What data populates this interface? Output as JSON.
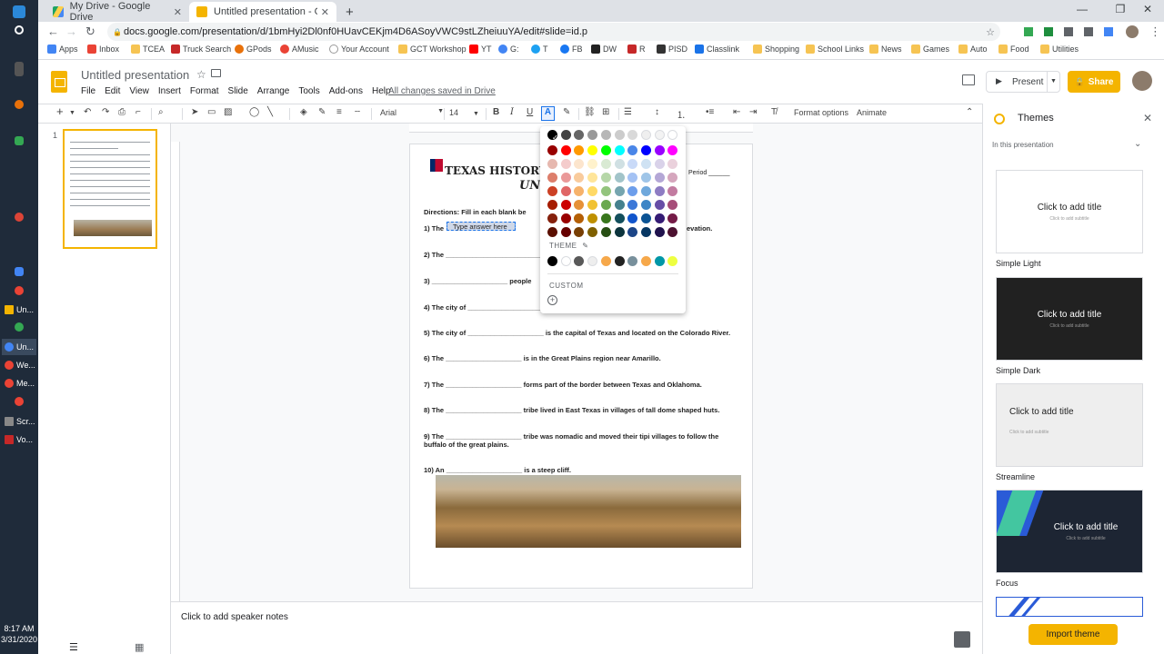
{
  "browser": {
    "tabs": [
      {
        "title": "My Drive - Google Drive",
        "active": false
      },
      {
        "title": "Untitled presentation - Google S",
        "active": true
      }
    ],
    "url": "docs.google.com/presentation/d/1bmHyi2Dl0nf0HUavCEKjm4D6ASoyVWC9stLZheiuuYA/edit#slide=id.p",
    "bookmarks": [
      "Apps",
      "Inbox",
      "TCEA",
      "Truck Search",
      "GPods",
      "AMusic",
      "Your Account",
      "GCT Workshop",
      "YT",
      "G:",
      "T",
      "FB",
      "DW",
      "R",
      "PISD",
      "Classlink",
      "Shopping",
      "School Links",
      "News",
      "Games",
      "Auto",
      "Food",
      "Utilities"
    ]
  },
  "taskbar": {
    "items": [
      "Un...",
      "Un...",
      "We...",
      "Me...",
      "Scr...",
      "Vo..."
    ],
    "time": "8:17 AM",
    "date": "3/31/2020"
  },
  "slides": {
    "title": "Untitled presentation",
    "menu": [
      "File",
      "Edit",
      "View",
      "Insert",
      "Format",
      "Slide",
      "Arrange",
      "Tools",
      "Add-ons",
      "Help"
    ],
    "save_status": "All changes saved in Drive",
    "present_label": "Present",
    "share_label": "Share",
    "font": "Arial",
    "font_size": "14",
    "format_options": "Format options",
    "animate": "Animate",
    "slide_number": "1",
    "notes_placeholder": "Click to add speaker notes"
  },
  "slide_content": {
    "title": "TEXAS HISTORY",
    "subtitle": "UNIT",
    "period": "Period ______",
    "directions": "Directions: Fill in each blank be",
    "selected_placeholder": "Type answer here",
    "questions": [
      "1) The",
      "2) The _________________________________________ evation.",
      "3) ____________________ people",
      "4) The city of _____________________________________________ Plains region.",
      "5) The city of ____________________ is the capital of Texas and located on the Colorado River.",
      "6) The ____________________ is in the Great Plains region near Amarillo.",
      "7) The ____________________ forms part of the border between Texas and Oklahoma.",
      "8) The ____________________ tribe lived in East Texas in villages of tall dome shaped huts.",
      "9) The ____________________ tribe was nomadic and moved their tipi villages to follow the buffalo of the great plains.",
      "10) An ____________________ is a steep cliff."
    ],
    "q1_suffix": "evation."
  },
  "color_picker": {
    "theme_label": "THEME",
    "custom_label": "CUSTOM",
    "row1": [
      "#000000",
      "#434343",
      "#666666",
      "#999999",
      "#b7b7b7",
      "#cccccc",
      "#d9d9d9",
      "#efefef",
      "#f3f3f3",
      "#ffffff"
    ],
    "row2": [
      "#980000",
      "#ff0000",
      "#ff9900",
      "#ffff00",
      "#00ff00",
      "#00ffff",
      "#4a86e8",
      "#0000ff",
      "#9900ff",
      "#ff00ff"
    ],
    "row3": [
      "#e6b8af",
      "#f4cccc",
      "#fce5cd",
      "#fff2cc",
      "#d9ead3",
      "#d0e0e3",
      "#c9daf8",
      "#cfe2f3",
      "#d9d2e9",
      "#ead1dc"
    ],
    "row4": [
      "#dd7e6b",
      "#ea9999",
      "#f9cb9c",
      "#ffe599",
      "#b6d7a8",
      "#a2c4c9",
      "#a4c2f4",
      "#9fc5e8",
      "#b4a7d6",
      "#d5a6bd"
    ],
    "row5": [
      "#cc4125",
      "#e06666",
      "#f6b26b",
      "#ffd966",
      "#93c47d",
      "#76a5af",
      "#6d9eeb",
      "#6fa8dc",
      "#8e7cc3",
      "#c27ba0"
    ],
    "row6": [
      "#a61c00",
      "#cc0000",
      "#e69138",
      "#f1c232",
      "#6aa84f",
      "#45818e",
      "#3c78d8",
      "#3d85c6",
      "#674ea7",
      "#a64d79"
    ],
    "row7": [
      "#85200c",
      "#990000",
      "#b45f06",
      "#bf9000",
      "#38761d",
      "#134f5c",
      "#1155cc",
      "#0b5394",
      "#351c75",
      "#741b47"
    ],
    "row8": [
      "#5b0f00",
      "#660000",
      "#783f04",
      "#7f6000",
      "#274e13",
      "#0c343d",
      "#1c4587",
      "#073763",
      "#20124d",
      "#4c1130"
    ],
    "theme_row": [
      "#000000",
      "#ffffff",
      "#595959",
      "#eeeeee",
      "#f6a84a",
      "#222222",
      "#78909c",
      "#f6a84a",
      "#0097a7",
      "#eeff41"
    ]
  },
  "themes_panel": {
    "title": "Themes",
    "section": "In this presentation",
    "cards": [
      {
        "name": "Simple Light",
        "title": "Click to add title",
        "subtitle": "Click to add subtitle"
      },
      {
        "name": "Simple Dark",
        "title": "Click to add title",
        "subtitle": "Click to add subtitle"
      },
      {
        "name": "Streamline",
        "title": "Click to add title",
        "subtitle": "Click to add subtitle"
      },
      {
        "name": "Focus",
        "title": "Click to add title",
        "subtitle": "Click to add subtitle"
      }
    ],
    "import_label": "Import theme"
  }
}
